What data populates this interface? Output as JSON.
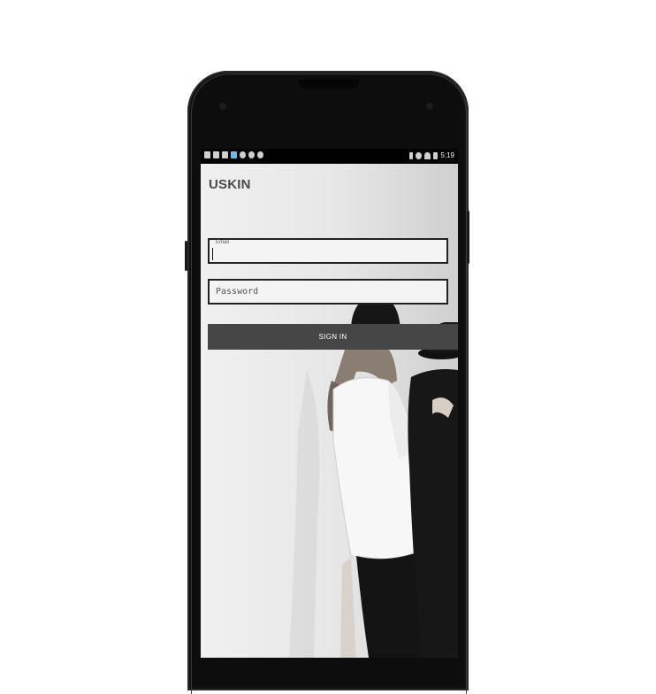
{
  "status_bar": {
    "left_icons": [
      "photo-icon",
      "app-icon",
      "phone-icon",
      "app-icon",
      "app-icon",
      "app-icon",
      "app-icon"
    ],
    "right_icons": [
      "bluetooth-icon",
      "do-not-disturb-icon",
      "wifi-icon",
      "battery-icon"
    ],
    "time": "5:19"
  },
  "app": {
    "title": "USKIN"
  },
  "login": {
    "email_label": "Email",
    "email_value": "",
    "password_placeholder": "Password",
    "signin_label": "SIGN IN"
  },
  "colors": {
    "screen_bg": "#ebebeb",
    "button_bg": "#464646",
    "phone_body": "#0d0d0d"
  }
}
